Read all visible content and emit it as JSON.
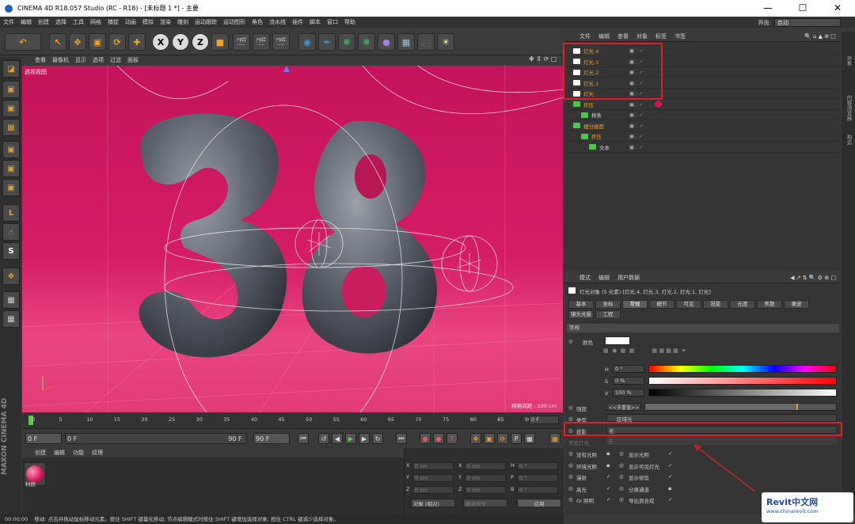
{
  "window": {
    "title": "CINEMA 4D R18.057 Studio (RC - R18) - [未标题 1 *] - 主要"
  },
  "menu": [
    "文件",
    "编辑",
    "创建",
    "选择",
    "工具",
    "网格",
    "捕捉",
    "动画",
    "模拟",
    "渲染",
    "雕刻",
    "运动跟踪",
    "运动图形",
    "角色",
    "流水线",
    "插件",
    "脚本",
    "窗口",
    "帮助"
  ],
  "interface": {
    "label": "界面:",
    "value": "启动"
  },
  "viewport": {
    "menu": [
      "查看",
      "摄像机",
      "显示",
      "选项",
      "过滤",
      "面板"
    ],
    "view_name": "透视视图",
    "grid_info": "网格间距 : 100 cm"
  },
  "timeline": {
    "ticks": [
      "0",
      "5",
      "10",
      "15",
      "20",
      "25",
      "30",
      "35",
      "40",
      "45",
      "50",
      "55",
      "60",
      "65",
      "70",
      "75",
      "80",
      "85",
      "90"
    ],
    "frame_readout": "0 F"
  },
  "playback": {
    "start": "0 F",
    "current": "0 F",
    "end": "90 F",
    "end2": "90 F"
  },
  "material": {
    "menu": [
      "创建",
      "编辑",
      "功能",
      "纹理"
    ],
    "name": "材质"
  },
  "coords": {
    "rows": [
      [
        "X",
        "0 cm",
        "X",
        "0 cm",
        "H",
        "0 °"
      ],
      [
        "Y",
        "0 cm",
        "Y",
        "0 cm",
        "P",
        "0 °"
      ],
      [
        "Z",
        "0 cm",
        "Z",
        "0 cm",
        "B",
        "0 °"
      ]
    ],
    "mode": "对象 (相对)",
    "size_mode": "绝对尺寸",
    "apply": "应用"
  },
  "status": {
    "time": "00:00:00",
    "text": "移动: 点击并拖动鼠标移动元素。按住 SHIFT 键量化移动; 节点编辑模式时按住 SHIFT 键增加选择对象; 按住 CTRL 键减少选择对象。"
  },
  "objects": {
    "menu": [
      "文件",
      "编辑",
      "查看",
      "对象",
      "标签",
      "书签"
    ],
    "items": [
      {
        "name": "灯光.4",
        "indent": 0,
        "hl": true
      },
      {
        "name": "灯光.3",
        "indent": 0,
        "hl": true
      },
      {
        "name": "灯光.2",
        "indent": 0,
        "hl": true
      },
      {
        "name": "灯光.1",
        "indent": 0,
        "hl": true
      },
      {
        "name": "灯光",
        "indent": 0,
        "hl": true
      },
      {
        "name": "挤压",
        "indent": 0,
        "hl": true
      },
      {
        "name": "样条",
        "indent": 1,
        "hl": false
      },
      {
        "name": "细分曲面",
        "indent": 0,
        "hl": true
      },
      {
        "name": "挤压",
        "indent": 1,
        "hl": true
      },
      {
        "name": "文本",
        "indent": 2,
        "hl": false
      }
    ]
  },
  "side_tabs": [
    "对象",
    "内容浏览器",
    "构造"
  ],
  "attributes": {
    "menu": [
      "模式",
      "编辑",
      "用户数据"
    ],
    "header": "灯光对象 (5 元素) [灯光.4, 灯光.3, 灯光.2, 灯光.1, 灯光]",
    "tabs1": [
      "基本",
      "坐标",
      "常规",
      "细节",
      "可见",
      "投影",
      "光度",
      "焦散",
      "噪波"
    ],
    "tabs2": [
      "镜头光晕",
      "工程"
    ],
    "section": "常规",
    "color_label": "颜色",
    "h": {
      "label": "H",
      "value": "0 °"
    },
    "s": {
      "label": "S",
      "value": "0 %"
    },
    "v": {
      "label": "V",
      "value": "100 %"
    },
    "intensity": {
      "label": "强度",
      "value": "<<多重值>>"
    },
    "type": {
      "label": "类型",
      "value": "区域光"
    },
    "shadow": {
      "label": "投影",
      "value": "无"
    },
    "visible_light": {
      "label": "可见灯光",
      "value": "无"
    },
    "checks_left": [
      "没有光照",
      "环境光照",
      "漫射",
      "高光",
      "GI 照明"
    ],
    "checks_right": [
      "显示光照",
      "显示可见灯光",
      "显示修剪",
      "分离通道",
      "导出到合成"
    ]
  },
  "watermark": {
    "brand": "Revit中文网",
    "url": "www.chinarevit.com"
  },
  "colors": {
    "accent": "#e8a030",
    "highlight": "#e21e26",
    "bg_top": "#d2135e",
    "bg_bottom": "#ee4f83"
  }
}
